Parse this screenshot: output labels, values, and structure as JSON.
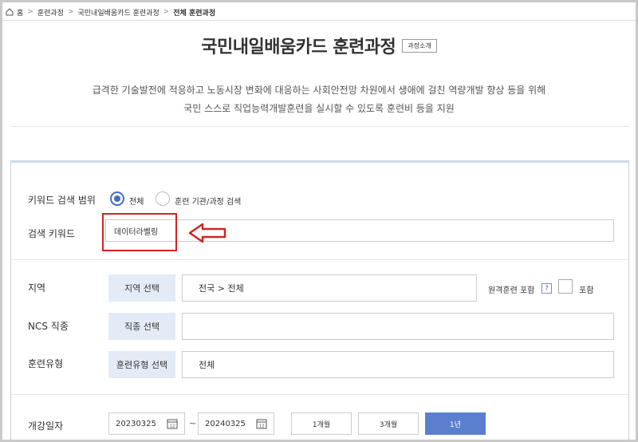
{
  "breadcrumb": {
    "items": [
      "홈",
      "훈련과정",
      "국민내일배움카드 훈련과정",
      "전체 훈련과정"
    ]
  },
  "header": {
    "title": "국민내일배움카드 훈련과정",
    "intro_button": "과정소개",
    "desc_line1": "급격한 기술발전에 적응하고 노동시장 변화에 대응하는 사회안전망 차원에서 생애에 걸친 역량개발 향상 등을 위해",
    "desc_line2": "국민 스스로 직업능력개발훈련을 실시할 수 있도록 훈련비 등을 지원"
  },
  "search": {
    "scope_label": "키워드 검색 범위",
    "scope_options": [
      {
        "label": "전체",
        "selected": true
      },
      {
        "label": "훈련 기관/과정 검색",
        "selected": false
      }
    ],
    "keyword_label": "검색 키워드",
    "keyword_value": "데이터라벨링",
    "region_label": "지역",
    "region_button": "지역 선택",
    "region_value": "전국 > 전체",
    "remote_label": "원격훈련 포함",
    "remote_help": "?",
    "remote_check_label": "포함",
    "ncs_label": "NCS 직종",
    "ncs_button": "직종 선택",
    "ncs_value": "",
    "type_label": "훈련유형",
    "type_button": "훈련유형 선택",
    "type_value": "전체",
    "date_label": "개강일자",
    "date_from": "20230325",
    "date_to": "20240325",
    "date_sep": "~",
    "cal_icon_text": "12",
    "periods": [
      {
        "label": "1개월",
        "active": false
      },
      {
        "label": "3개월",
        "active": false
      },
      {
        "label": "1년",
        "active": true
      }
    ]
  },
  "colors": {
    "accent": "#3f6fc7",
    "active_button": "#5b7fcf",
    "select_button_bg": "#e3ebf6",
    "annotation_red": "#d12424"
  }
}
